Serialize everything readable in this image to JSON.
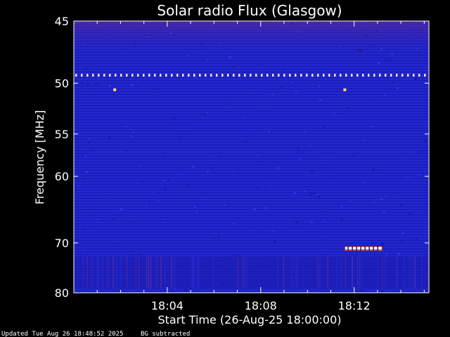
{
  "chart_data": {
    "type": "heatmap",
    "title": "Solar radio Flux (Glasgow)",
    "xlabel": "Start Time (26-Aug-25 18:00:00)",
    "ylabel": "Frequency [MHz]",
    "x_unit": "minutes after 18:00:00",
    "xlim": [
      0,
      15.2
    ],
    "ylim": [
      45,
      80
    ],
    "yscale": "reciprocal (frequency increases downward)",
    "x_ticks": [
      {
        "value": 4,
        "label": "18:04"
      },
      {
        "value": 8,
        "label": "18:08"
      },
      {
        "value": 12,
        "label": "18:12"
      }
    ],
    "y_ticks": [
      {
        "value": 45,
        "label": "45"
      },
      {
        "value": 50,
        "label": "50"
      },
      {
        "value": 55,
        "label": "55"
      },
      {
        "value": 60,
        "label": "60"
      },
      {
        "value": 70,
        "label": "70"
      },
      {
        "value": 80,
        "label": "80"
      }
    ],
    "background_color": "#1e22c8",
    "colormap": [
      "#12127a",
      "#1e22c8",
      "#b01a6a",
      "#ffffff"
    ],
    "features": [
      {
        "name": "interference line",
        "type": "dotted-line",
        "frequency_mhz": 49.3,
        "x_start": 0,
        "x_end": 15.2,
        "color": "#ffe8b0"
      },
      {
        "name": "spot 1",
        "type": "point",
        "minute": 1.75,
        "frequency_mhz": 50.6,
        "color": "#ffd580"
      },
      {
        "name": "spot 2",
        "type": "point",
        "minute": 11.6,
        "frequency_mhz": 50.6,
        "color": "#ffd580"
      },
      {
        "name": "burst",
        "type": "bar",
        "minute_start": 11.6,
        "minute_end": 13.2,
        "frequency_mhz": 71.0,
        "color": "#ffffff"
      }
    ]
  },
  "footer": {
    "updated": "Updated Tue Aug 26 18:48:52 2025",
    "note": "BG subtracted"
  }
}
